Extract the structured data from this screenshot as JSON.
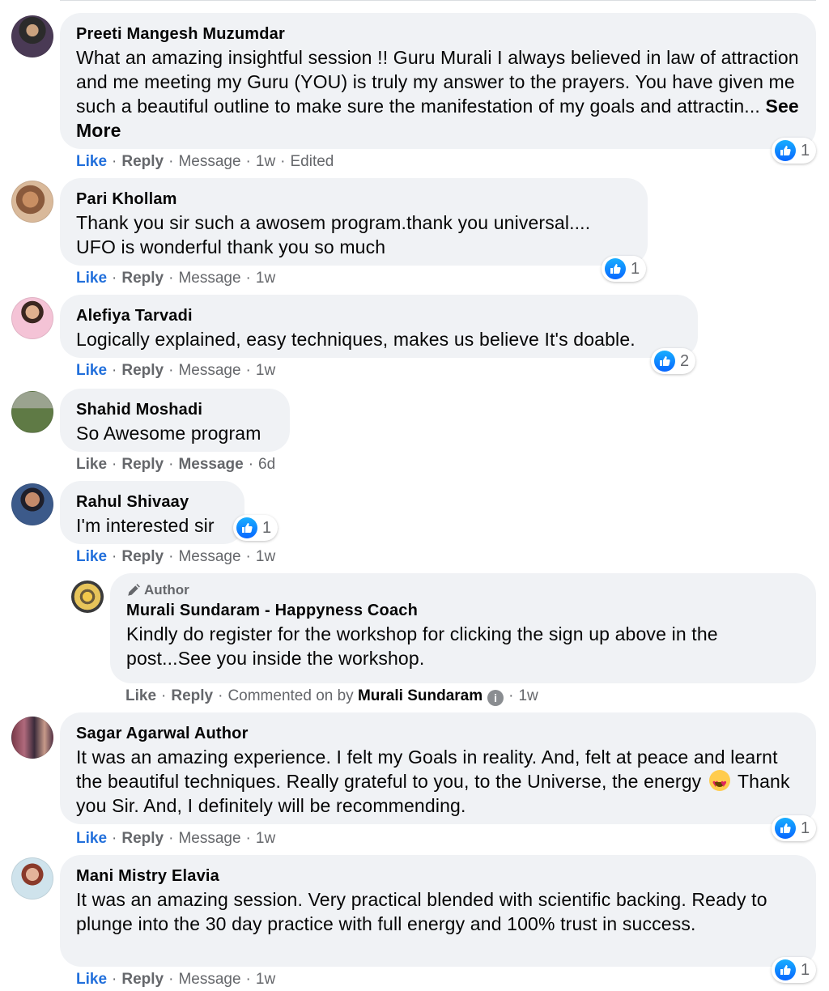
{
  "labels": {
    "like": "Like",
    "reply": "Reply",
    "message": "Message",
    "edited": "Edited",
    "see_more": "See More",
    "author": "Author",
    "commented_on_by": "Commented on by"
  },
  "comments": [
    {
      "name": "Preeti Mangesh Muzumdar",
      "text": "What an amazing insightful session !! Guru Murali I always believed in law of attraction and me meeting my Guru (YOU) is truly my answer to the prayers. You have given me such a beautiful outline to make sure the manifestation of my goals and attractin... ",
      "time": "1w",
      "reactions": "1"
    },
    {
      "name": "Pari Khollam",
      "text": "Thank you sir such a awosem program.thank you universal.... UFO is wonderful thank you so much",
      "time": "1w",
      "reactions": "1"
    },
    {
      "name": "Alefiya Tarvadi",
      "text": "Logically explained, easy techniques, makes us believe It's doable.",
      "time": "1w",
      "reactions": "2"
    },
    {
      "name": "Shahid Moshadi",
      "text": "So Awesome program",
      "time": "6d"
    },
    {
      "name": "Rahul Shivaay",
      "text": "I'm interested sir",
      "time": "1w",
      "reactions": "1"
    },
    {
      "name": "Sagar Agarwal Author",
      "text_before": "It was an amazing experience. I felt my Goals in reality. And, felt at peace and learnt the beautiful techniques. Really grateful to you, to the Universe, the energy",
      "text_after": " Thank you Sir. And, I definitely will be recommending.",
      "time": "1w",
      "reactions": "1"
    },
    {
      "name": "Mani Mistry Elavia",
      "text": "It was an amazing session. Very practical blended with scientific backing. Ready to plunge into the 30 day practice with full energy and 100% trust in success.",
      "time": "1w",
      "reactions": "1"
    }
  ],
  "reply": {
    "name": "Murali Sundaram - Happyness Coach",
    "text": "Kindly do register for the workshop for clicking the sign up above in the post...See you inside the workshop.",
    "commented_by": "Murali Sundaram",
    "time": "1w"
  },
  "colors": {
    "bubble": "#f0f2f5",
    "link_blue": "#216fdb",
    "meta_gray": "#65676b"
  },
  "icons": [
    "like-reaction-icon",
    "pencil-icon",
    "info-icon",
    "heart-eyes-emoji-icon"
  ]
}
